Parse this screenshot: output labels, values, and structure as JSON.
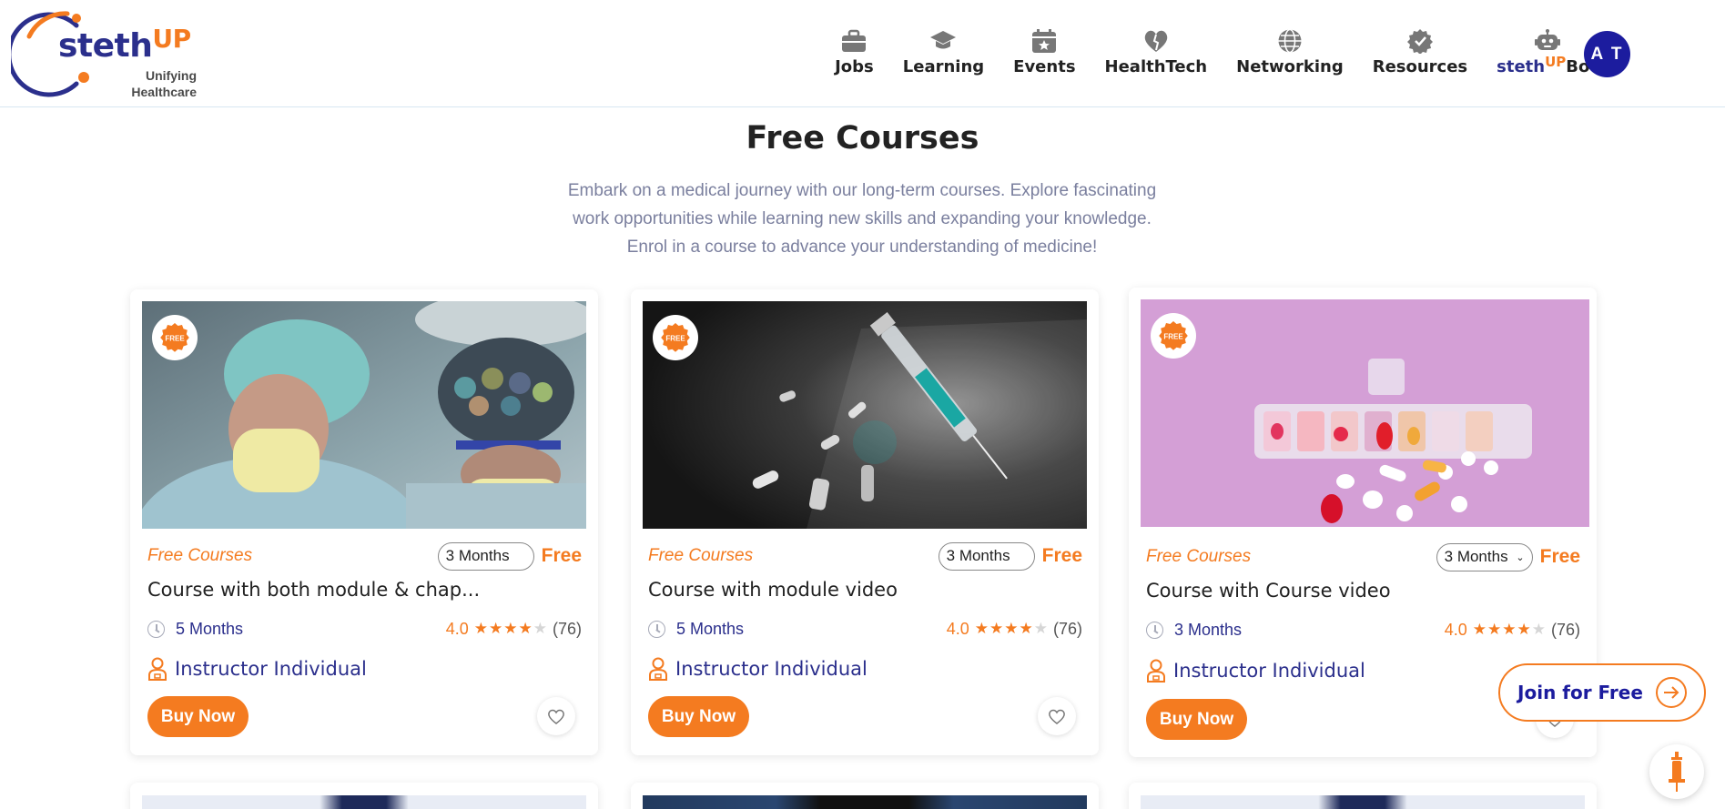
{
  "brand": {
    "name_main": "steth",
    "name_accent": "UP",
    "tagline_line1": "Unifying",
    "tagline_line2": "Healthcare",
    "primary_color": "#2b2f8c",
    "accent_color": "#f47b20"
  },
  "nav": {
    "items": [
      {
        "label": "Jobs",
        "icon": "briefcase-icon"
      },
      {
        "label": "Learning",
        "icon": "graduation-cap-icon"
      },
      {
        "label": "Events",
        "icon": "calendar-star-icon"
      },
      {
        "label": "HealthTech",
        "icon": "heart-tech-icon"
      },
      {
        "label": "Networking",
        "icon": "globe-icon"
      },
      {
        "label": "Resources",
        "icon": "gear-check-icon"
      }
    ],
    "bot": {
      "main": "steth",
      "accent": "UP",
      "suffix": "Bot",
      "icon": "robot-icon"
    },
    "avatar_initials": "A T"
  },
  "page": {
    "title": "Free Courses",
    "description": "Embark on a medical journey with our long-term courses. Explore fascinating work opportunities while learning new skills and expanding your knowledge. Enrol in a course to advance your understanding of medicine!"
  },
  "courses": [
    {
      "badge": "FREE",
      "category": "Free Courses",
      "duration_option": "3 Months",
      "price": "Free",
      "title": "Course with both module & chap...",
      "duration": "5 Months",
      "rating": "4.0",
      "stars_filled": 4,
      "reviews": "(76)",
      "instructor": "Instructor Individual",
      "buy_label": "Buy Now"
    },
    {
      "badge": "FREE",
      "category": "Free Courses",
      "duration_option": "3 Months",
      "price": "Free",
      "title": "Course with module video",
      "duration": "5 Months",
      "rating": "4.0",
      "stars_filled": 4,
      "reviews": "(76)",
      "instructor": "Instructor Individual",
      "buy_label": "Buy Now"
    },
    {
      "badge": "FREE",
      "category": "Free Courses",
      "duration_option": "3 Months",
      "price": "Free",
      "title": "Course with Course video",
      "duration": "3 Months",
      "rating": "4.0",
      "stars_filled": 4,
      "reviews": "(76)",
      "instructor": "Instructor Individual",
      "buy_label": "Buy Now"
    }
  ],
  "floating": {
    "join_label": "Join for Free"
  }
}
